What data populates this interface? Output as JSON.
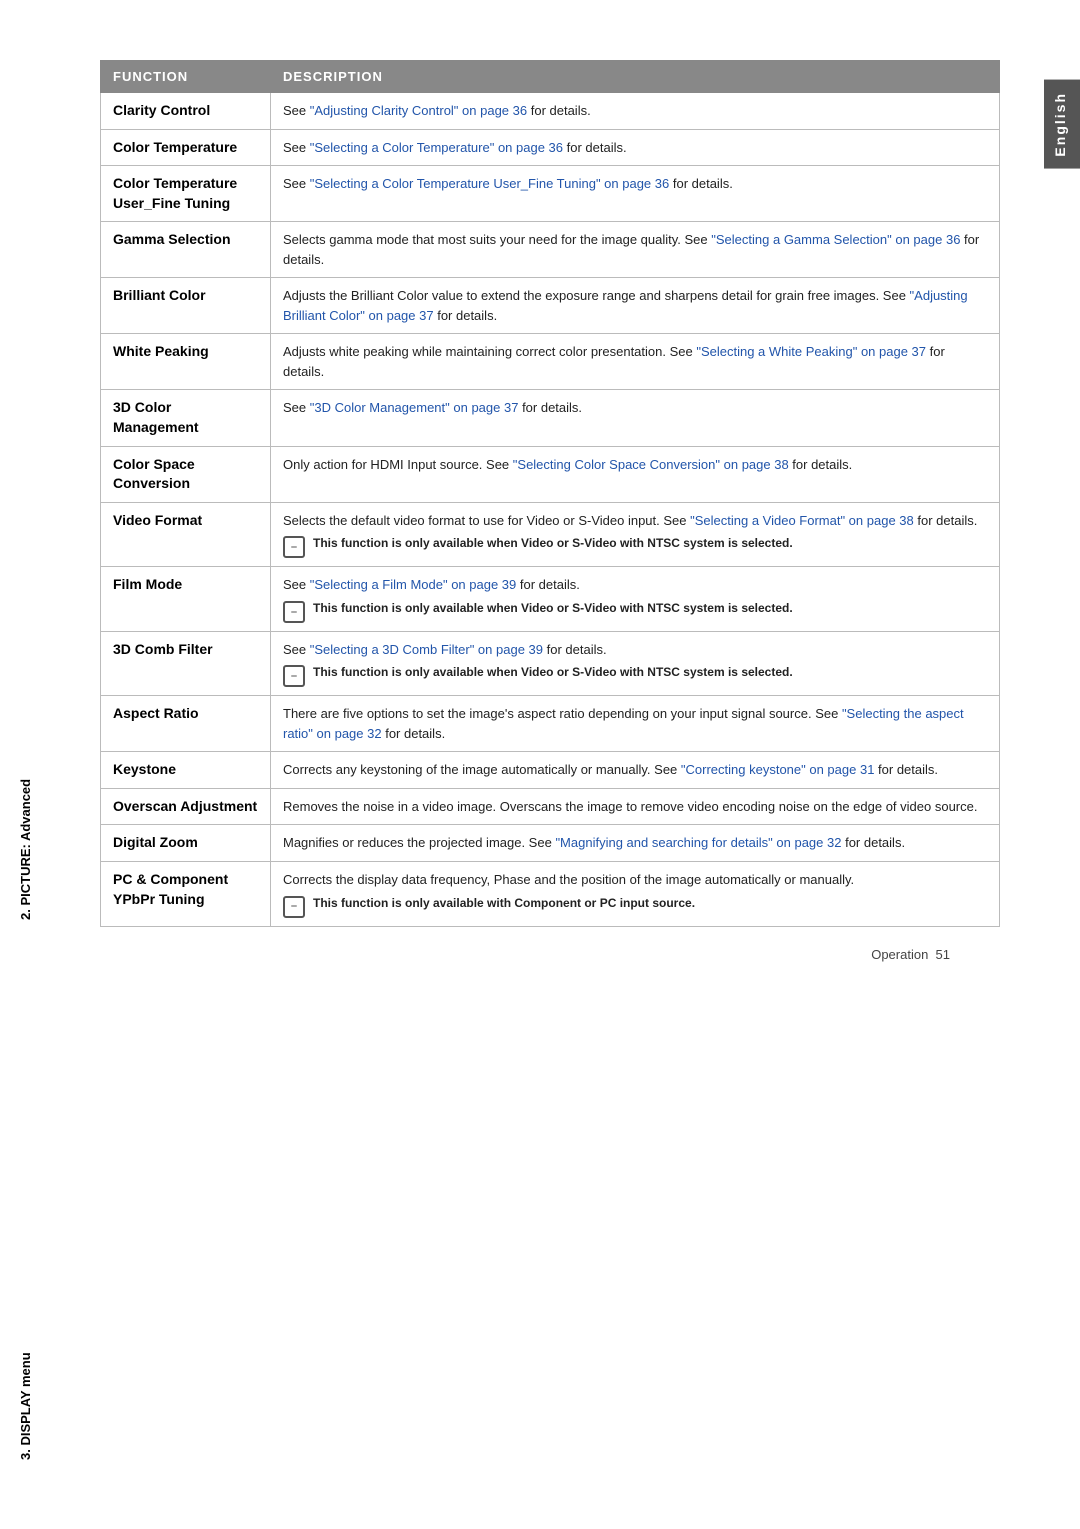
{
  "side_tab": {
    "label": "English"
  },
  "sidebar_labels": {
    "picture": "2. PICTURE: Advanced",
    "display": "3. DISPLAY menu"
  },
  "table": {
    "headers": [
      "FUNCTION",
      "DESCRIPTION"
    ],
    "rows": [
      {
        "func": "Clarity Control",
        "desc_text": "See ",
        "desc_link": "\"Adjusting Clarity Control\" on page 36",
        "desc_suffix": " for details.",
        "notes": []
      },
      {
        "func": "Color Temperature",
        "desc_text": "See ",
        "desc_link": "\"Selecting a Color Temperature\" on page 36",
        "desc_suffix": " for details.",
        "notes": []
      },
      {
        "func": "Color Temperature User_Fine Tuning",
        "desc_text": "See ",
        "desc_link": "\"Selecting a Color Temperature User_Fine Tuning\" on page 36",
        "desc_suffix": " for details.",
        "notes": []
      },
      {
        "func": "Gamma Selection",
        "desc_text": "Selects gamma mode that most suits your need for the image quality. See ",
        "desc_link": "\"Selecting a Gamma Selection\" on page 36",
        "desc_suffix": " for details.",
        "notes": []
      },
      {
        "func": "Brilliant Color",
        "desc_text": "Adjusts the Brilliant Color value to extend the exposure range and sharpens detail for grain free images. See ",
        "desc_link": "\"Adjusting Brilliant Color\" on page 37",
        "desc_suffix": " for details.",
        "notes": []
      },
      {
        "func": "White Peaking",
        "desc_text": "Adjusts white peaking while maintaining correct color presentation. See ",
        "desc_link": "\"Selecting a White Peaking\" on page 37",
        "desc_suffix": " for details.",
        "notes": []
      },
      {
        "func": "3D Color Management",
        "desc_text": "See ",
        "desc_link": "\"3D Color Management\" on page 37",
        "desc_suffix": " for details.",
        "notes": []
      },
      {
        "func": "Color Space Conversion",
        "desc_text": "Only action for HDMI Input source. See ",
        "desc_link": "\"Selecting Color Space Conversion\" on page 38",
        "desc_suffix": " for details.",
        "notes": []
      },
      {
        "func": "Video Format",
        "desc_text": "Selects the default video format to use for Video or S-Video input. See ",
        "desc_link": "\"Selecting a Video Format\" on page 38",
        "desc_suffix": " for details.",
        "notes": [
          "This function is only available when Video or S-Video with NTSC system is selected."
        ]
      },
      {
        "func": "Film Mode",
        "desc_text": "See ",
        "desc_link": "\"Selecting a Film Mode\" on page 39",
        "desc_suffix": " for details.",
        "notes": [
          "This function is only available when Video or S-Video with NTSC system is selected."
        ]
      },
      {
        "func": "3D Comb Filter",
        "desc_text": "See ",
        "desc_link": "\"Selecting a 3D Comb Filter\" on page 39",
        "desc_suffix": " for details.",
        "notes": [
          "This function is only available when Video or S-Video with NTSC system is selected."
        ]
      },
      {
        "func": "Aspect Ratio",
        "desc_text": "There are five options to set the image's aspect ratio depending on your input signal source. See ",
        "desc_link": "\"Selecting the aspect ratio\" on page 32",
        "desc_suffix": " for details.",
        "notes": []
      },
      {
        "func": "Keystone",
        "desc_text": "Corrects any keystoning of the image automatically or manually. See ",
        "desc_link": "\"Correcting keystone\" on page 31",
        "desc_suffix": " for details.",
        "notes": []
      },
      {
        "func": "Overscan Adjustment",
        "desc_text": "Removes the noise in a video image. Overscans the image to remove video encoding noise on the edge of video source.",
        "desc_link": "",
        "desc_suffix": "",
        "notes": []
      },
      {
        "func": "Digital Zoom",
        "desc_text": "Magnifies or reduces the projected image. See ",
        "desc_link": "\"Magnifying and searching for details\" on page 32",
        "desc_suffix": " for details.",
        "notes": []
      },
      {
        "func": "PC & Component YPbPr Tuning",
        "desc_text": "Corrects the display data frequency, Phase and the position of the image automatically or manually.",
        "desc_link": "",
        "desc_suffix": "",
        "notes": [
          "This function is only available with Component or PC input source."
        ]
      }
    ]
  },
  "footer": {
    "operation_label": "Operation",
    "page_number": "51"
  }
}
